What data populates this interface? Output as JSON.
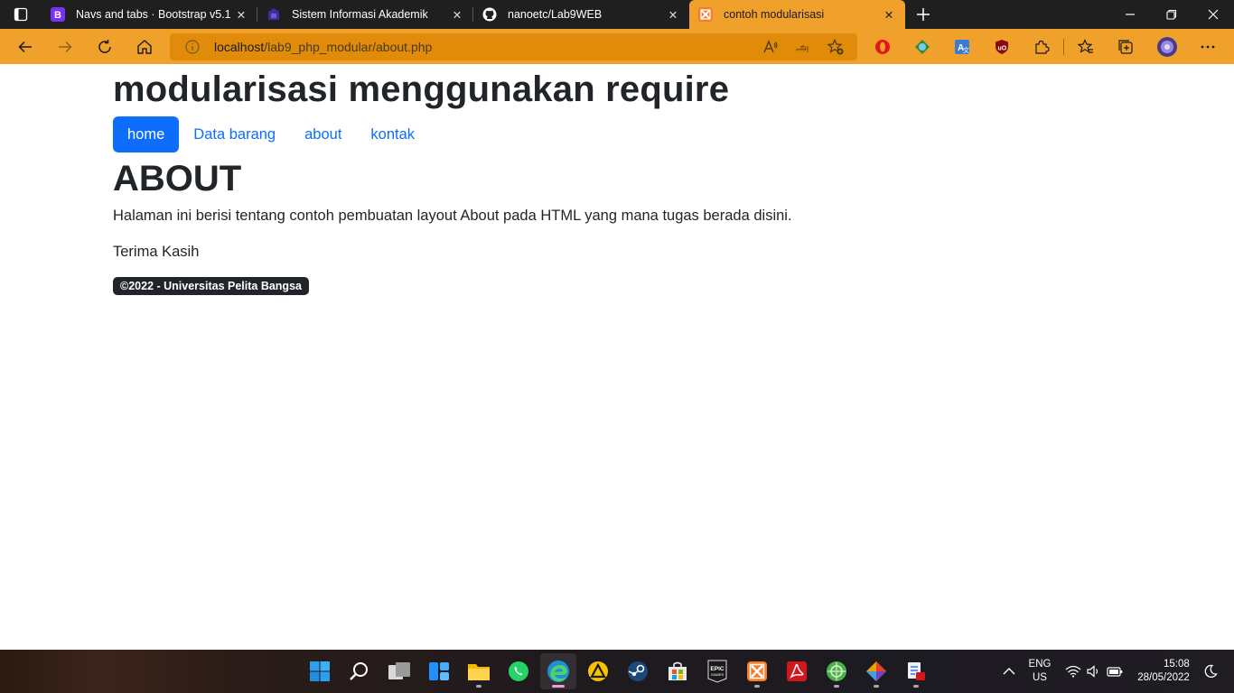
{
  "browser": {
    "tabs": [
      {
        "title": "Navs and tabs · Bootstrap v5.1",
        "favicon": "bootstrap-icon",
        "active": false
      },
      {
        "title": "Sistem Informasi Akademik",
        "favicon": "university-icon",
        "active": false
      },
      {
        "title": "nanoetc/Lab9WEB",
        "favicon": "github-icon",
        "active": false
      },
      {
        "title": "contoh modularisasi",
        "favicon": "xampp-icon",
        "active": true
      }
    ],
    "url_host": "localhost",
    "url_path": "/lab9_php_modular/about.php",
    "accent_color": "#f0a12c"
  },
  "page": {
    "site_title": "modularisasi menggunakan require",
    "nav": [
      {
        "label": "home",
        "active": true
      },
      {
        "label": "Data barang",
        "active": false
      },
      {
        "label": "about",
        "active": false
      },
      {
        "label": "kontak",
        "active": false
      }
    ],
    "heading": "ABOUT",
    "paragraph1": "Halaman ini berisi tentang contoh pembuatan layout About pada HTML yang mana tugas berada disini.",
    "paragraph2": "Terima Kasih",
    "footer": "©2022 - Universitas Pelita Bangsa",
    "primary_color": "#0d6efd"
  },
  "taskbar": {
    "apps": [
      "start-icon",
      "search-icon",
      "task-view-icon",
      "widgets-icon",
      "file-explorer-icon",
      "whatsapp-icon",
      "edge-icon",
      "app-triangle-icon",
      "steam-icon",
      "store-icon",
      "epic-games-icon",
      "xampp-icon",
      "acrobat-icon",
      "app-green-icon",
      "git-icon",
      "app-tool-icon"
    ],
    "lang_line1": "ENG",
    "lang_line2": "US",
    "time": "15:08",
    "date": "28/05/2022"
  }
}
